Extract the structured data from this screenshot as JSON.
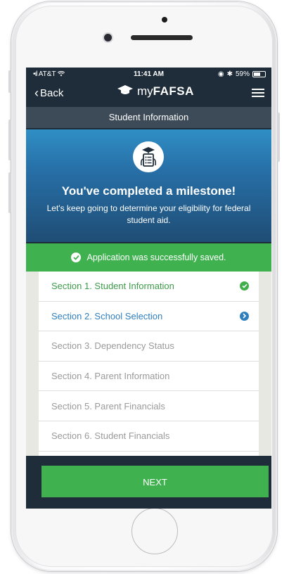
{
  "status_bar": {
    "carrier": "AT&T",
    "time": "11:41 AM",
    "battery": "59%"
  },
  "nav": {
    "back_label": "Back",
    "brand_prefix": "my",
    "brand_name": "FAFSA"
  },
  "page_header": "Student Information",
  "milestone": {
    "title": "You've completed a milestone!",
    "subtitle": "Let's keep going to determine your eligibility for federal student aid."
  },
  "banner": {
    "message": "Application was successfully saved."
  },
  "sections": [
    {
      "label": "Section 1. Student Information",
      "state": "done"
    },
    {
      "label": "Section 2. School Selection",
      "state": "current"
    },
    {
      "label": "Section 3. Dependency Status",
      "state": "pending"
    },
    {
      "label": "Section 4. Parent Information",
      "state": "pending"
    },
    {
      "label": "Section 5. Parent Financials",
      "state": "pending"
    },
    {
      "label": "Section 6. Student Financials",
      "state": "pending"
    }
  ],
  "next_button": "NEXT",
  "colors": {
    "header_dark": "#1f2d3a",
    "section_bar": "#3d4a57",
    "accent_green": "#3fb24f",
    "accent_blue": "#2f7fbd",
    "banner_blue": "#2f8fc5"
  }
}
